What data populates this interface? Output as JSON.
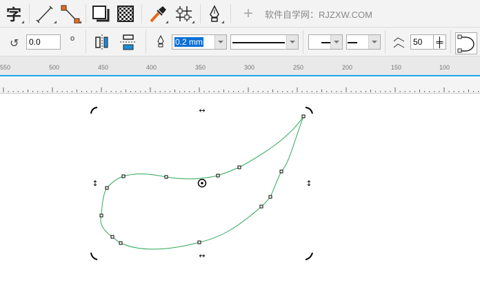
{
  "toolbar_top": {
    "tools": [
      {
        "icon": "text-tool-icon"
      },
      {
        "icon": "dimension-tool-icon"
      },
      {
        "icon": "connector-tool-icon"
      },
      {
        "icon": "drop-shadow-icon"
      },
      {
        "icon": "transparency-icon"
      },
      {
        "icon": "eyedropper-icon"
      },
      {
        "icon": "grid-snap-icon"
      },
      {
        "icon": "pen-outline-icon"
      },
      {
        "icon": "add-icon"
      }
    ],
    "text_tool_glyph": "字",
    "watermark": "软件自学网：RJZXW.COM"
  },
  "property_bar": {
    "rotation_value": "0.0",
    "degree_symbol": "o",
    "outline_width": "0.2 mm",
    "miter_value": "50",
    "accent": "#1a8fd8"
  },
  "ruler": {
    "labels": [
      "550",
      "500",
      "450",
      "400",
      "350",
      "300",
      "250",
      "200",
      "150",
      "100"
    ]
  },
  "canvas": {
    "curve_color": "#2aa654"
  }
}
